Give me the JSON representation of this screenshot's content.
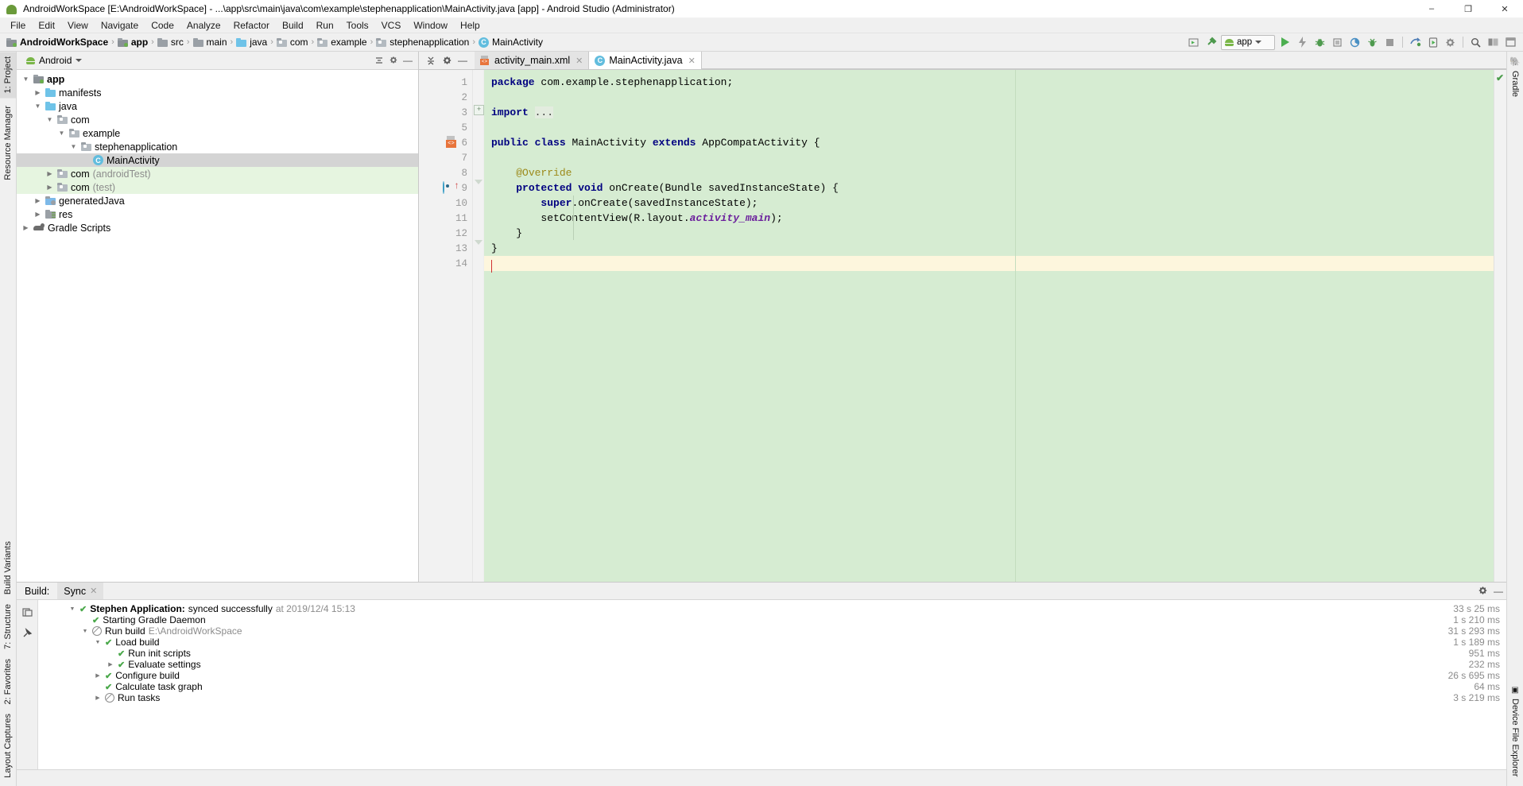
{
  "window": {
    "title": "AndroidWorkSpace [E:\\AndroidWorkSpace] - ...\\app\\src\\main\\java\\com\\example\\stephenapplication\\MainActivity.java [app] - Android Studio (Administrator)",
    "app_icon": "android-studio-icon",
    "minimize": "–",
    "maximize": "❐",
    "close": "✕"
  },
  "menubar": {
    "items": [
      "File",
      "Edit",
      "View",
      "Navigate",
      "Code",
      "Analyze",
      "Refactor",
      "Build",
      "Run",
      "Tools",
      "VCS",
      "Window",
      "Help"
    ]
  },
  "breadcrumb": {
    "separator": "›",
    "items": [
      {
        "label": "AndroidWorkSpace",
        "icon": "module-icon",
        "bold": true
      },
      {
        "label": "app",
        "icon": "module-icon",
        "bold": true
      },
      {
        "label": "src",
        "icon": "folder-icon",
        "bold": false
      },
      {
        "label": "main",
        "icon": "folder-icon",
        "bold": false
      },
      {
        "label": "java",
        "icon": "source-folder-icon",
        "bold": false
      },
      {
        "label": "com",
        "icon": "package-icon",
        "bold": false
      },
      {
        "label": "example",
        "icon": "package-icon",
        "bold": false
      },
      {
        "label": "stephenapplication",
        "icon": "package-icon",
        "bold": false
      },
      {
        "label": "MainActivity",
        "icon": "java-class-icon",
        "bold": false
      }
    ]
  },
  "toolbar": {
    "run_config": "app",
    "run_config_icon": "android-icon",
    "buttons": [
      {
        "name": "layout-editor-icon",
        "glyph": "▶"
      },
      {
        "name": "build-hammer-icon",
        "glyph": "⚒"
      },
      {
        "name": "run-icon",
        "glyph": "▶"
      },
      {
        "name": "apply-changes-icon",
        "glyph": "⚡"
      },
      {
        "name": "debug-icon",
        "glyph": "⚙"
      },
      {
        "name": "run-coverage-icon",
        "glyph": "▣"
      },
      {
        "name": "profile-icon",
        "glyph": "◔"
      },
      {
        "name": "attach-debugger-icon",
        "glyph": "⎇"
      },
      {
        "name": "stop-icon",
        "glyph": "■"
      },
      {
        "name": "sync-gradle-icon",
        "glyph": "↻"
      },
      {
        "name": "avd-manager-icon",
        "glyph": "▢"
      },
      {
        "name": "sdk-manager-icon",
        "glyph": "⚙"
      },
      {
        "name": "search-icon",
        "glyph": "⌕"
      },
      {
        "name": "project-structure-icon",
        "glyph": "▤"
      },
      {
        "name": "layout-inspector-icon",
        "glyph": "□"
      }
    ]
  },
  "left_tool_tabs": [
    {
      "label": "1: Project",
      "icon": "project-icon",
      "selected": true
    },
    {
      "label": "Resource Manager",
      "icon": "resource-icon",
      "selected": false
    },
    {
      "label": "Build Variants",
      "icon": "build-variants-icon",
      "selected": false
    },
    {
      "label": "7: Structure",
      "icon": "structure-icon",
      "selected": false
    },
    {
      "label": "2: Favorites",
      "icon": "star-icon",
      "selected": false
    },
    {
      "label": "Layout Captures",
      "icon": "layout-captures-icon",
      "selected": false
    }
  ],
  "right_tool_tabs": [
    {
      "label": "Gradle",
      "icon": "gradle-elephant-icon"
    },
    {
      "label": "Device File Explorer",
      "icon": "device-file-explorer-icon"
    }
  ],
  "project_panel": {
    "view_selector": "Android",
    "view_icon": "android-icon",
    "collapse_icon": "≡",
    "settings_icon": "⚙",
    "hide_icon": "—",
    "tree": [
      {
        "label": "app",
        "suffix": "",
        "depth": 0,
        "arrow": "▼",
        "icon": "module-icon",
        "bold": true,
        "state": "normal"
      },
      {
        "label": "manifests",
        "suffix": "",
        "depth": 1,
        "arrow": "▶",
        "icon": "folder-blue-icon",
        "bold": false,
        "state": "normal"
      },
      {
        "label": "java",
        "suffix": "",
        "depth": 1,
        "arrow": "▼",
        "icon": "folder-blue-icon",
        "bold": false,
        "state": "normal"
      },
      {
        "label": "com",
        "suffix": "",
        "depth": 2,
        "arrow": "▼",
        "icon": "package-icon",
        "bold": false,
        "state": "normal"
      },
      {
        "label": "example",
        "suffix": "",
        "depth": 3,
        "arrow": "▼",
        "icon": "package-icon",
        "bold": false,
        "state": "normal"
      },
      {
        "label": "stephenapplication",
        "suffix": "",
        "depth": 4,
        "arrow": "▼",
        "icon": "package-icon",
        "bold": false,
        "state": "normal"
      },
      {
        "label": "MainActivity",
        "suffix": "",
        "depth": 5,
        "arrow": "",
        "icon": "java-class-icon",
        "bold": false,
        "state": "selected"
      },
      {
        "label": "com",
        "suffix": "(androidTest)",
        "depth": 2,
        "arrow": "▶",
        "icon": "package-icon",
        "bold": false,
        "state": "test"
      },
      {
        "label": "com",
        "suffix": "(test)",
        "depth": 2,
        "arrow": "▶",
        "icon": "package-icon",
        "bold": false,
        "state": "test"
      },
      {
        "label": "generatedJava",
        "suffix": "",
        "depth": 1,
        "arrow": "▶",
        "icon": "generated-folder-icon",
        "bold": false,
        "state": "normal"
      },
      {
        "label": "res",
        "suffix": "",
        "depth": 1,
        "arrow": "▶",
        "icon": "res-folder-icon",
        "bold": false,
        "state": "normal"
      },
      {
        "label": "Gradle Scripts",
        "suffix": "",
        "depth": 0,
        "arrow": "▶",
        "icon": "gradle-elephant-icon",
        "bold": false,
        "state": "normal"
      }
    ]
  },
  "editor": {
    "tabs": [
      {
        "label": "activity_main.xml",
        "icon": "xml-layout-icon",
        "active": false,
        "close": "✕"
      },
      {
        "label": "MainActivity.java",
        "icon": "java-class-icon",
        "active": true,
        "close": "✕"
      }
    ],
    "tools": [
      {
        "name": "collapse-all-icon",
        "glyph": "⤓"
      },
      {
        "name": "settings-gear-icon",
        "glyph": "⚙"
      },
      {
        "name": "hide-panel-icon",
        "glyph": "—"
      }
    ],
    "line_numbers": [
      "1",
      "2",
      "3",
      "5",
      "6",
      "7",
      "8",
      "9",
      "10",
      "11",
      "12",
      "13",
      "14"
    ],
    "analysis_status_icon": "inspection-ok-check",
    "code_lines": [
      {
        "num": "1",
        "html": "<span class=\"k\">package</span> com.example.stephenapplication;"
      },
      {
        "num": "2",
        "html": ""
      },
      {
        "num": "3",
        "html": "<span class=\"k\">import</span> <span class=\"dots\">...</span>"
      },
      {
        "num": "5",
        "html": ""
      },
      {
        "num": "6",
        "html": "<span class=\"k\">public</span> <span class=\"k\">class</span> MainActivity <span class=\"k\">extends</span> AppCompatActivity {"
      },
      {
        "num": "7",
        "html": ""
      },
      {
        "num": "8",
        "html": "    <span class=\"ann\">@Override</span>"
      },
      {
        "num": "9",
        "html": "    <span class=\"k\">protected</span> <span class=\"k\">void</span> onCreate(Bundle savedInstanceState) {"
      },
      {
        "num": "10",
        "html": "        <span class=\"k\">super</span>.onCreate(savedInstanceState);"
      },
      {
        "num": "11",
        "html": "        setContentView(R.layout.<span class=\"fld\">activity_main</span>);"
      },
      {
        "num": "12",
        "html": "    }"
      },
      {
        "num": "13",
        "html": "}"
      },
      {
        "num": "14",
        "html": ""
      }
    ],
    "code_plain": [
      "package com.example.stephenapplication;",
      "",
      "import ...",
      "",
      "public class MainActivity extends AppCompatActivity {",
      "",
      "    @Override",
      "    protected void onCreate(Bundle savedInstanceState) {",
      "        super.onCreate(savedInstanceState);",
      "        setContentView(R.layout.activity_main);",
      "    }",
      "}",
      ""
    ]
  },
  "build_panel": {
    "label": "Build:",
    "tab": "Sync",
    "tab_close": "✕",
    "settings_icon": "⚙",
    "hide_icon": "—",
    "side_buttons": [
      {
        "name": "toggle-tasks-icon",
        "glyph": "⧉"
      },
      {
        "name": "pin-tab-icon",
        "glyph": "✒"
      }
    ],
    "rows": [
      {
        "depth": 0,
        "arrow": "▼",
        "status": "check",
        "text": "Stephen Application:",
        "bold": true,
        "text2": " synced successfully",
        "gray": " at 2019/12/4 15:13",
        "duration": "33 s 25 ms"
      },
      {
        "depth": 1,
        "arrow": "",
        "status": "check",
        "text": "Starting Gradle Daemon",
        "bold": false,
        "text2": "",
        "gray": "",
        "duration": "1 s 210 ms"
      },
      {
        "depth": 1,
        "arrow": "▼",
        "status": "circle",
        "text": "Run build",
        "bold": false,
        "text2": "",
        "gray": " E:\\AndroidWorkSpace",
        "duration": "31 s 293 ms"
      },
      {
        "depth": 2,
        "arrow": "▼",
        "status": "check",
        "text": "Load build",
        "bold": false,
        "text2": "",
        "gray": "",
        "duration": "1 s 189 ms"
      },
      {
        "depth": 3,
        "arrow": "",
        "status": "check",
        "text": "Run init scripts",
        "bold": false,
        "text2": "",
        "gray": "",
        "duration": "951 ms"
      },
      {
        "depth": 3,
        "arrow": "▶",
        "status": "check",
        "text": "Evaluate settings",
        "bold": false,
        "text2": "",
        "gray": "",
        "duration": "232 ms"
      },
      {
        "depth": 2,
        "arrow": "▶",
        "status": "check",
        "text": "Configure build",
        "bold": false,
        "text2": "",
        "gray": "",
        "duration": "26 s 695 ms"
      },
      {
        "depth": 2,
        "arrow": "",
        "status": "check",
        "text": "Calculate task graph",
        "bold": false,
        "text2": "",
        "gray": "",
        "duration": "64 ms"
      },
      {
        "depth": 2,
        "arrow": "▶",
        "status": "circle",
        "text": "Run tasks",
        "bold": false,
        "text2": "",
        "gray": "",
        "duration": "3 s 219 ms"
      }
    ]
  },
  "colors": {
    "code_background": "#d6ecd2",
    "cursor_line": "#fdf6dd",
    "test_source_row": "#e6f5e0",
    "selection": "#d4d4d4",
    "keyword": "#000080",
    "annotation": "#9c8a1a",
    "field": "#6b1f9c",
    "accent_green": "#4aa84a",
    "chrome": "#f0f0f0"
  }
}
